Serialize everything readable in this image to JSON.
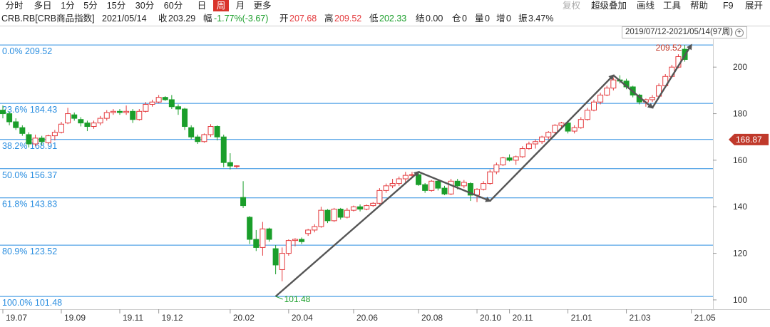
{
  "toolbar": {
    "periods": [
      "分时",
      "多日",
      "1分",
      "5分",
      "15分",
      "30分",
      "60分",
      "日",
      "周",
      "月",
      "更多"
    ],
    "active_period": "周",
    "menus": [
      "复权",
      "超级叠加",
      "画线",
      "工具",
      "帮助",
      "F9",
      "展开"
    ]
  },
  "info": {
    "symbol": "CRB.RB[CRB商品指数]",
    "date": "2021/05/14",
    "close_label": "收",
    "close": "203.29",
    "change_label": "幅",
    "change": "-1.77%(-3.67)",
    "open_label": "开",
    "open": "207.68",
    "high_label": "高",
    "high": "209.52",
    "low_label": "低",
    "low": "202.33",
    "settle_label": "结",
    "settle": "0.00",
    "oi_label": "仓",
    "oi": "0",
    "volume_label": "量",
    "volume": "0",
    "increase_label": "增",
    "increase": "0",
    "amplitude_label": "振",
    "amplitude": "3.47%"
  },
  "range_label": "2019/07/12-2021/05/14(97周)",
  "colors": {
    "up": "#e4393c",
    "down": "#1a9e2a",
    "fib_line": "#2a8ee0",
    "arrow": "#555555",
    "price_tag": "#c0392b"
  },
  "chart_data": {
    "type": "candlestick",
    "title": "",
    "ylim": [
      96,
      212
    ],
    "y_ticks": [
      100,
      120,
      140,
      160,
      180,
      200
    ],
    "x_tick_labels": [
      "19.07",
      "19.09",
      "19.11",
      "19.12",
      "20.02",
      "20.04",
      "20.06",
      "20.08",
      "20.10",
      "20.11",
      "21.01",
      "21.03",
      "21.05"
    ],
    "x_tick_index": [
      0,
      9,
      18,
      24,
      35,
      44,
      54,
      64,
      73,
      78,
      87,
      96,
      106
    ],
    "candles": [
      [
        181.5,
        183.5,
        178,
        180
      ],
      [
        180,
        181,
        175,
        176.5
      ],
      [
        176.5,
        178,
        173,
        174
      ],
      [
        174,
        175,
        170.5,
        171.5
      ],
      [
        171,
        172,
        165.5,
        167
      ],
      [
        167,
        171,
        166,
        169.5
      ],
      [
        169.5,
        170.5,
        166.5,
        168
      ],
      [
        167.5,
        171,
        166.8,
        170.5
      ],
      [
        170.5,
        173,
        168.5,
        172
      ],
      [
        172,
        176.5,
        171.5,
        175.5
      ],
      [
        176,
        182.5,
        175.5,
        180
      ],
      [
        179.5,
        180.5,
        177,
        178
      ],
      [
        177.5,
        178.5,
        174.5,
        176
      ],
      [
        176,
        177,
        172.5,
        174.5
      ],
      [
        174.5,
        177,
        173.5,
        176
      ],
      [
        176,
        179,
        175,
        178
      ],
      [
        178,
        181.5,
        177,
        180.5
      ],
      [
        180.5,
        182,
        179.5,
        181
      ],
      [
        181,
        182,
        179.5,
        180.5
      ],
      [
        180.5,
        183.5,
        179.5,
        181
      ],
      [
        181,
        182,
        176,
        177.5
      ],
      [
        177.5,
        182,
        177,
        181
      ],
      [
        181,
        185,
        180.5,
        184
      ],
      [
        184,
        186,
        183,
        185
      ],
      [
        185,
        188,
        184.5,
        187
      ],
      [
        187,
        187.5,
        185.5,
        186
      ],
      [
        186,
        188,
        182,
        183
      ],
      [
        183,
        184,
        179.5,
        182
      ],
      [
        182,
        182.5,
        173,
        174.5
      ],
      [
        174,
        175,
        169,
        170
      ],
      [
        170,
        171,
        167,
        168
      ],
      [
        168,
        171.5,
        167.5,
        171
      ],
      [
        171,
        175.5,
        170,
        174.5
      ],
      [
        174.5,
        175,
        168.5,
        170
      ],
      [
        170,
        171,
        157,
        159
      ],
      [
        159,
        163,
        156,
        157.5
      ],
      [
        157.5,
        157.8,
        156.5,
        157.6
      ],
      [
        144,
        151,
        139.5,
        140.5
      ],
      [
        135.5,
        136,
        124,
        126
      ],
      [
        126,
        130,
        121,
        122.5
      ],
      [
        122.5,
        133.5,
        119,
        130.5
      ],
      [
        130.5,
        131,
        125,
        126
      ],
      [
        122,
        123.5,
        111,
        115
      ],
      [
        113,
        122.5,
        108,
        120
      ],
      [
        120,
        126,
        119,
        125.5
      ],
      [
        125.5,
        126.5,
        123,
        126
      ],
      [
        126,
        126.8,
        124,
        125
      ],
      [
        128.5,
        130.5,
        127.5,
        130
      ],
      [
        130,
        132.5,
        129,
        131.5
      ],
      [
        131.5,
        140,
        131,
        138.5
      ],
      [
        138.5,
        139,
        133,
        134
      ],
      [
        134,
        139.5,
        133.5,
        139
      ],
      [
        139,
        139.5,
        134.5,
        135.5
      ],
      [
        135.5,
        139.5,
        135,
        138.5
      ],
      [
        138.5,
        140.5,
        138,
        140
      ],
      [
        140,
        141,
        138,
        139
      ],
      [
        139,
        141,
        138.5,
        140.5
      ],
      [
        140.5,
        142,
        140,
        141.5
      ],
      [
        141.5,
        148,
        141,
        147
      ],
      [
        147,
        150,
        146,
        149
      ],
      [
        149,
        152,
        148,
        150
      ],
      [
        150,
        153,
        149,
        152
      ],
      [
        152,
        155,
        150.5,
        153.5
      ],
      [
        153.5,
        155,
        152.5,
        153.8
      ],
      [
        153.8,
        154.5,
        149,
        149.5
      ],
      [
        149.5,
        150.2,
        146,
        147
      ],
      [
        147,
        151.5,
        146.5,
        151
      ],
      [
        151,
        151.5,
        147,
        148
      ],
      [
        148,
        149,
        145,
        145.5
      ],
      [
        145.5,
        152,
        145,
        151
      ],
      [
        151,
        152,
        147.5,
        149
      ],
      [
        149,
        151.5,
        148,
        150.5
      ],
      [
        150,
        150.5,
        142.5,
        145
      ],
      [
        145,
        148,
        142,
        147.5
      ],
      [
        147.5,
        151,
        147,
        150
      ],
      [
        150,
        156,
        149.5,
        155
      ],
      [
        155,
        159,
        154,
        158
      ],
      [
        158,
        161.5,
        157.5,
        161
      ],
      [
        161,
        162.5,
        159.5,
        160
      ],
      [
        160,
        162,
        158,
        161.5
      ],
      [
        161.5,
        166,
        161,
        165
      ],
      [
        165,
        168,
        164.5,
        167
      ],
      [
        167,
        169,
        165,
        168
      ],
      [
        168,
        170.5,
        167,
        170
      ],
      [
        170,
        172.5,
        169,
        172
      ],
      [
        172,
        175.5,
        171,
        175
      ],
      [
        175,
        176.5,
        173.5,
        176
      ],
      [
        176,
        177,
        171.5,
        172.5
      ],
      [
        172.5,
        175,
        171.5,
        174
      ],
      [
        174,
        178.5,
        173.5,
        177.5
      ],
      [
        177.5,
        182.5,
        177,
        181.5
      ],
      [
        181.5,
        186,
        181,
        185
      ],
      [
        185,
        189,
        184,
        188
      ],
      [
        188,
        192,
        187.5,
        191
      ],
      [
        191,
        195.5,
        190,
        194.5
      ],
      [
        194.5,
        196.5,
        193,
        194
      ],
      [
        194,
        195,
        190.5,
        191.5
      ],
      [
        191.5,
        192,
        187,
        188
      ],
      [
        188,
        188.5,
        184,
        185
      ],
      [
        185,
        186.5,
        183,
        186
      ],
      [
        186,
        188,
        185,
        187
      ],
      [
        187.5,
        193,
        187,
        192
      ],
      [
        192,
        197,
        191.5,
        196
      ],
      [
        196,
        201,
        195.5,
        200
      ],
      [
        200,
        205.5,
        199.5,
        204.5
      ],
      [
        207.68,
        209.52,
        202.33,
        203.29
      ]
    ],
    "fib_levels": [
      {
        "label": "0.0%",
        "value": 209.52
      },
      {
        "label": "23.6%",
        "value": 184.43
      },
      {
        "label": "38.2%",
        "value": 168.91
      },
      {
        "label": "50.0%",
        "value": 156.37
      },
      {
        "label": "61.8%",
        "value": 143.83
      },
      {
        "label": "80.9%",
        "value": 123.52
      },
      {
        "label": "100.0%",
        "value": 101.48
      }
    ],
    "low_annotation": {
      "text": "101.48",
      "index": 42,
      "value": 101.48
    },
    "high_annotation": {
      "text": "209.52",
      "index": 106,
      "value": 209.52
    },
    "current_price_tag": "168.87",
    "trend_arrows": [
      {
        "from": [
          42,
          101.5
        ],
        "to": [
          64,
          155
        ]
      },
      {
        "from": [
          64,
          155
        ],
        "to": [
          75,
          142.5
        ]
      },
      {
        "from": [
          75,
          142.5
        ],
        "to": [
          94,
          196.5
        ]
      },
      {
        "from": [
          94,
          196.5
        ],
        "to": [
          100,
          182.5
        ]
      },
      {
        "from": [
          100,
          182.5
        ],
        "to": [
          106,
          209.5
        ]
      }
    ]
  }
}
